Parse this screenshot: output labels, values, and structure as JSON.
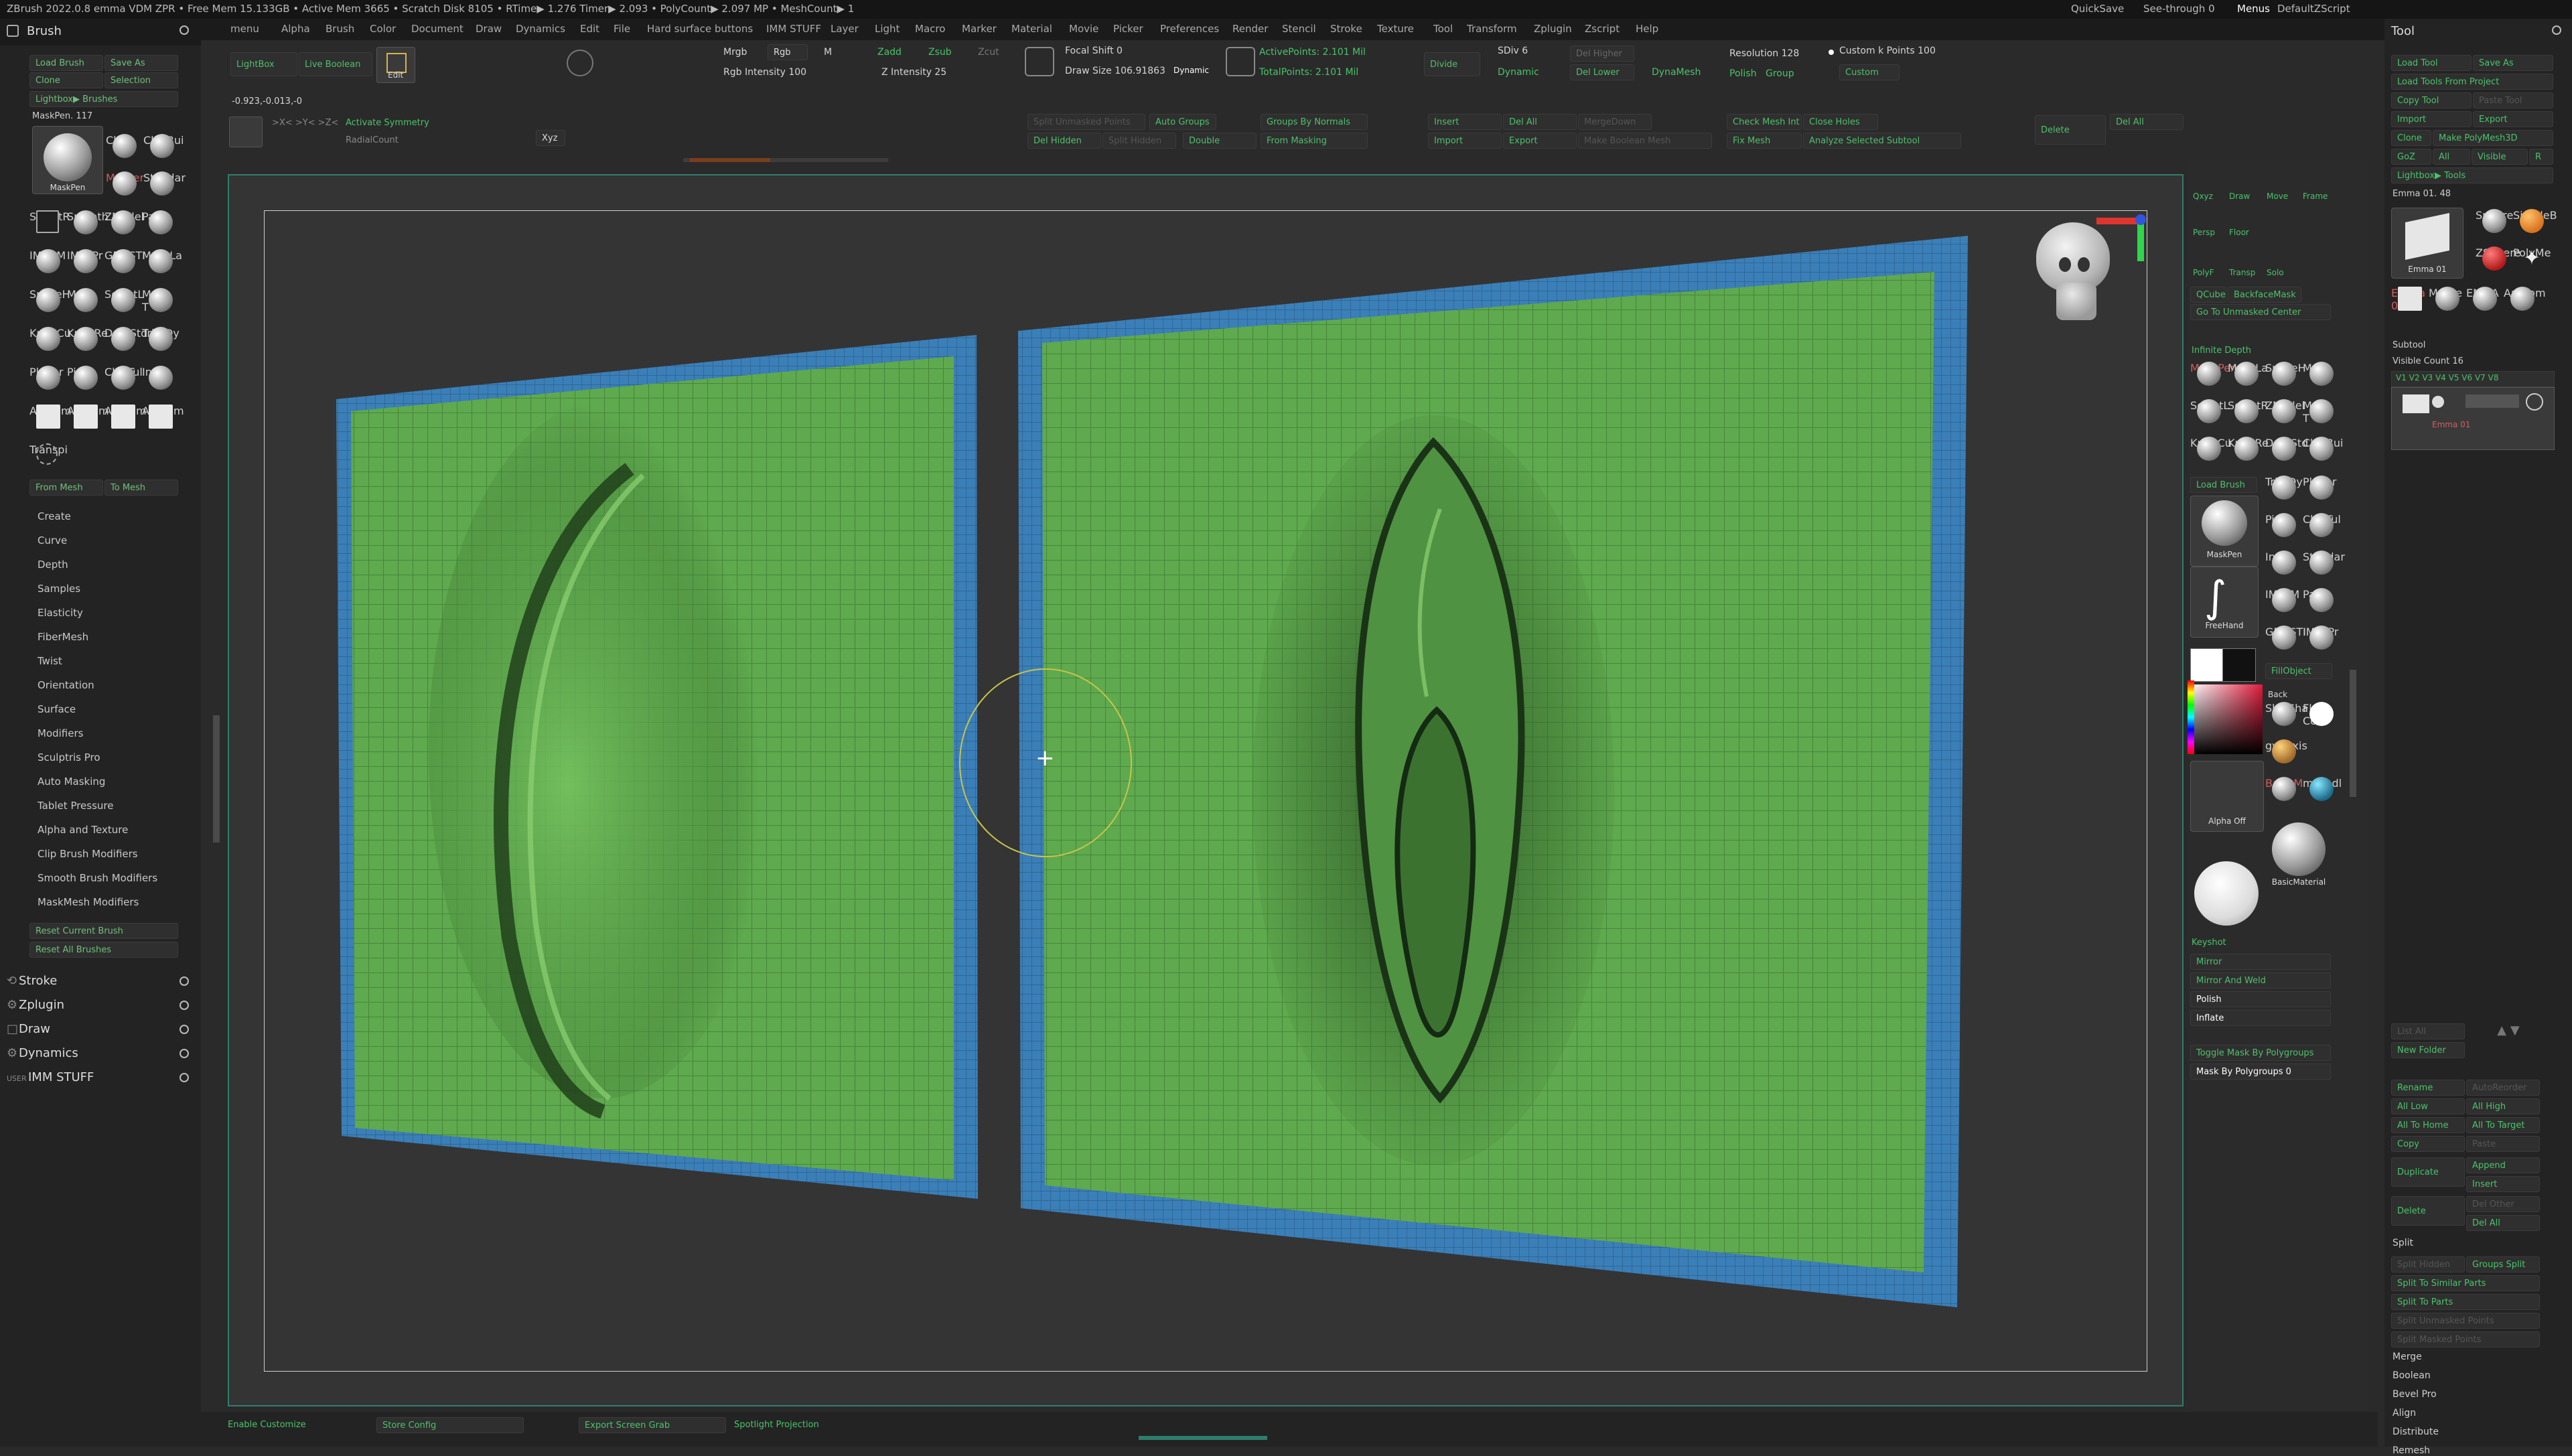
{
  "app": {
    "title": "ZBrush 2022.0.8   emma VDM ZPR   • Free Mem 15.133GB • Active Mem 3665 • Scratch Disk 8105 • RTime▶ 1.276 Timer▶ 2.093 • PolyCount▶ 2.097 MP • MeshCount▶ 1",
    "quicksave": "QuickSave",
    "see_through": "See-through  0",
    "menus": "Menus",
    "script": "DefaultZScript"
  },
  "menubar": [
    "menu",
    "Alpha",
    "Brush",
    "Color",
    "Document",
    "Draw",
    "Dynamics",
    "Edit",
    "File",
    "Hard surface buttons",
    "IMM STUFF",
    "Layer",
    "Light",
    "Macro",
    "Marker",
    "Material",
    "Movie",
    "Picker",
    "Preferences",
    "Render",
    "Stencil",
    "Stroke",
    "Texture",
    "Tool",
    "Transform",
    "Zplugin",
    "Zscript",
    "Help"
  ],
  "left_panel": {
    "header": "Brush",
    "buttons": [
      "Load Brush",
      "Save As",
      "Clone",
      "Selection",
      "Lightbox▶ Brushes"
    ],
    "maskpen_label": "MaskPen. 117",
    "brushes": [
      [
        "MaskPen",
        "Clay",
        "ClayBui"
      ],
      [
        "",
        "Masker",
        "Standar"
      ],
      [
        "SelectR",
        "Smooth",
        "ZModel",
        "Paint"
      ],
      [
        "IMM_M",
        "IMM Pr",
        "GEMSTI",
        "MaskLa"
      ],
      [
        "SnakeH",
        "Move",
        "SelectL",
        "Move T"
      ],
      [
        "KnifeCu",
        "KnifeRe",
        "DamStd",
        "TrimDy"
      ],
      [
        "Planar",
        "Pinch",
        "ClayTul",
        "Inflat"
      ],
      [
        "Anatom",
        "Anatom",
        "Anatom",
        "Anatom"
      ],
      [
        "Transpi"
      ]
    ],
    "from_mesh": "From Mesh",
    "to_mesh": "To Mesh",
    "sub_items": [
      "Create",
      "Curve",
      "Depth",
      "Samples",
      "Elasticity",
      "FiberMesh",
      "Twist",
      "Orientation",
      "Surface",
      "Modifiers",
      "Sculptris Pro",
      "Auto Masking",
      "Tablet Pressure",
      "Alpha and Texture",
      "Clip Brush Modifiers",
      "Smooth Brush Modifiers",
      "MaskMesh Modifiers"
    ],
    "reset_current": "Reset Current Brush",
    "reset_all": "Reset All Brushes",
    "sections": [
      "Stroke",
      "Zplugin",
      "Draw",
      "Dynamics",
      "IMM STUFF"
    ]
  },
  "top": {
    "lightbox": "LightBox",
    "live_boolean": "Live Boolean",
    "edit": "Edit",
    "mrgb": "Mrgb",
    "rgb": "Rgb",
    "m": "M",
    "zadd": "Zadd",
    "zsub": "Zsub",
    "zcut": "Zcut",
    "rgb_intensity": "Rgb Intensity 100",
    "z_intensity": "Z Intensity 25",
    "focal_shift": "Focal Shift 0",
    "draw_size": "Draw Size 106.91863",
    "dynamic": "Dynamic",
    "active_points": "ActivePoints: 2.101 Mil",
    "total_points": "TotalPoints: 2.101 Mil",
    "divide": "Divide",
    "sdiv": "SDiv 6",
    "dynamic2": "Dynamic",
    "del_lower": "Del Lower",
    "del_higher": "Del Higher",
    "dynamesh": "DynaMesh",
    "resolution": "Resolution 128",
    "polish": "Polish",
    "group": "Group",
    "custom_points": "Custom k Points 100",
    "custom": "Custom",
    "coords": "-0.923,-0.013,-0",
    "activate_symmetry": "Activate Symmetry",
    "radial_count": "RadialCount",
    "xyz": ">X<  >Y<  >Z<",
    "split_unmasked": "Split Unmasked Points",
    "auto_groups": "Auto Groups",
    "groups_by_normals": "Groups By Normals",
    "insert": "Insert",
    "del_all": "Del All",
    "merge_down": "MergeDown",
    "check_mesh": "Check Mesh Int",
    "close_holes": "Close Holes",
    "delete": "Delete",
    "del_all2": "Del All",
    "del_hidden": "Del Hidden",
    "split_hidden": "Split Hidden",
    "double": "Double",
    "from_masking": "From Masking",
    "import": "Import",
    "export": "Export",
    "make_boolean": "Make Boolean Mesh",
    "fix_mesh": "Fix Mesh",
    "analyze": "Analyze Selected Subtool"
  },
  "viewport_tools": {
    "xyz": "Qxyz",
    "draw": "Draw",
    "move": "Move",
    "frame": "Frame",
    "persp": "Persp",
    "floor": "Floor",
    "polyf": "PolyF",
    "transp": "Transp",
    "solo": "Solo",
    "qcube": "QCube",
    "backfacemask": "BackfaceMask",
    "go_to_unmasked": "Go To Unmasked Center",
    "infinite_depth": "Infinite Depth",
    "brushes": [
      "MaskPen",
      "MaskLa",
      "SnakeH",
      "Move",
      "SelectL",
      "SelectR",
      "ZModel",
      "Move T",
      "KnifeCu",
      "KnifeRe",
      "DamStd",
      "ClayBui",
      "TrimDy",
      "Planar",
      "Pinch",
      "ClayTul",
      "Inflat",
      "Standar",
      "IMM M",
      "Paint",
      "GEMSTI",
      "IMM Pr"
    ],
    "load_brush": "Load Brush",
    "freehand": "FreeHand",
    "fill_object": "FillObject",
    "back": "Back",
    "skinshade": "SkinSha",
    "flat_color": "Flat Col",
    "gw_oxis": "gw_oxis",
    "basicm": "BasicM",
    "mah_dl": "mah_dl",
    "alpha_off": "Alpha Off",
    "basic_material": "BasicMaterial",
    "keyshot": "Keyshot",
    "mirror": "Mirror",
    "mirror_weld": "Mirror And Weld",
    "polish": "Polish",
    "inflate": "Inflate",
    "toggle_mask": "Toggle Mask By Polygroups",
    "mask_polygroups": "Mask By Polygroups 0"
  },
  "right_panel": {
    "header": "Tool",
    "buttons": [
      "Load Tool",
      "Save As",
      "Load Tools From Project",
      "Copy Tool",
      "Paste Tool",
      "Import",
      "Export",
      "Clone",
      "Make PolyMesh3D",
      "GoZ",
      "All",
      "Visible",
      "R",
      "Lightbox▶ Tools"
    ],
    "current_tool": "Emma 01. 48",
    "tools": [
      "Emma 01",
      "Sphere",
      "SimpleB",
      "ZSphere",
      "PolyMe",
      "Merge",
      "EMMA",
      "Anatom"
    ],
    "subtool": "Subtool",
    "visible_count": "Visible Count 16",
    "subtool_name": "Emma 01",
    "list_all": "List All",
    "new_folder": "New Folder",
    "rename": "Rename",
    "auto_reorder": "AutoReorder",
    "all_low": "All Low",
    "all_high": "All High",
    "all_to_home": "All To Home",
    "all_to_target": "All To Target",
    "copy": "Copy",
    "paste": "Paste",
    "duplicate": "Duplicate",
    "append": "Append",
    "insert": "Insert",
    "delete": "Delete",
    "del_other": "Del Other",
    "del_all": "Del All",
    "split": "Split",
    "split_hidden": "Split Hidden",
    "groups_split": "Groups Split",
    "split_similar": "Split To Similar Parts",
    "split_parts": "Split To Parts",
    "split_unmasked": "Split Unmasked Points",
    "split_masked": "Split Masked Points",
    "merge": "Merge",
    "boolean": "Boolean",
    "bevel_pro": "Bevel Pro",
    "align": "Align",
    "distribute": "Distribute",
    "remesh": "Remesh"
  },
  "bottom": {
    "enable_customize": "Enable Customize",
    "store_config": "Store Config",
    "export_screen_grab": "Export Screen Grab",
    "spotlight_projection": "Spotlight Projection"
  },
  "colors": {
    "mesh_green": "#5fa94e",
    "mesh_blue": "#3b7fb8",
    "accent_green": "#49c46a",
    "viewport_border": "#2f7d6b"
  }
}
